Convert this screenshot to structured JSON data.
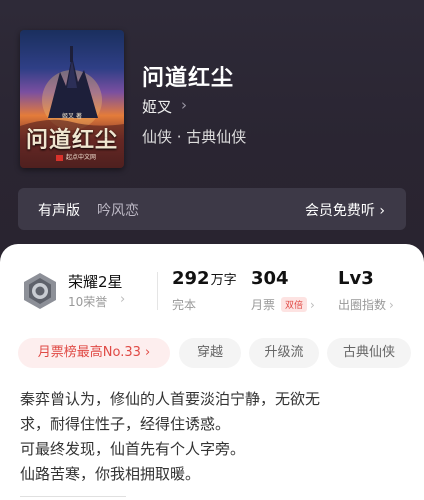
{
  "book": {
    "title": "问道红尘",
    "author": "姬叉",
    "author_arrow": "›",
    "genre": "仙侠 · 古典仙侠",
    "cover": {
      "title": "问道红尘",
      "author_line": "姬叉 著",
      "publisher": "起点中文网"
    }
  },
  "audio_bar": {
    "label": "有声版",
    "narrator": "吟风恋",
    "free_listen": "会员免费听 ›"
  },
  "honor": {
    "title": "荣耀2星",
    "sub": "10荣誉",
    "arrow": "›",
    "badge_icon": "honor-star-badge"
  },
  "stats": {
    "words": {
      "value": "292",
      "unit": "万字",
      "label": "完本"
    },
    "tickets": {
      "value": "304",
      "label": "月票",
      "badge": "双倍",
      "arrow": "›"
    },
    "level": {
      "value": "Lv3",
      "label": "出圈指数",
      "arrow": "›"
    }
  },
  "tags": [
    {
      "label": "月票榜最高No.33 ›"
    },
    {
      "label": "穿越"
    },
    {
      "label": "升级流"
    },
    {
      "label": "古典仙侠"
    }
  ],
  "intro": {
    "lines": [
      "秦弈曾认为，修仙的人首要淡泊宁静，无欲无",
      "求，耐得住性子，经得住诱惑。",
      "可最终发现，仙首先有个人字旁。",
      "仙路苦寒，你我相拥取暖。"
    ]
  },
  "colors": {
    "hero_bg": "#2e2a38",
    "accent_red": "#e04a45",
    "audio_bar_bg": "#3d3947"
  }
}
